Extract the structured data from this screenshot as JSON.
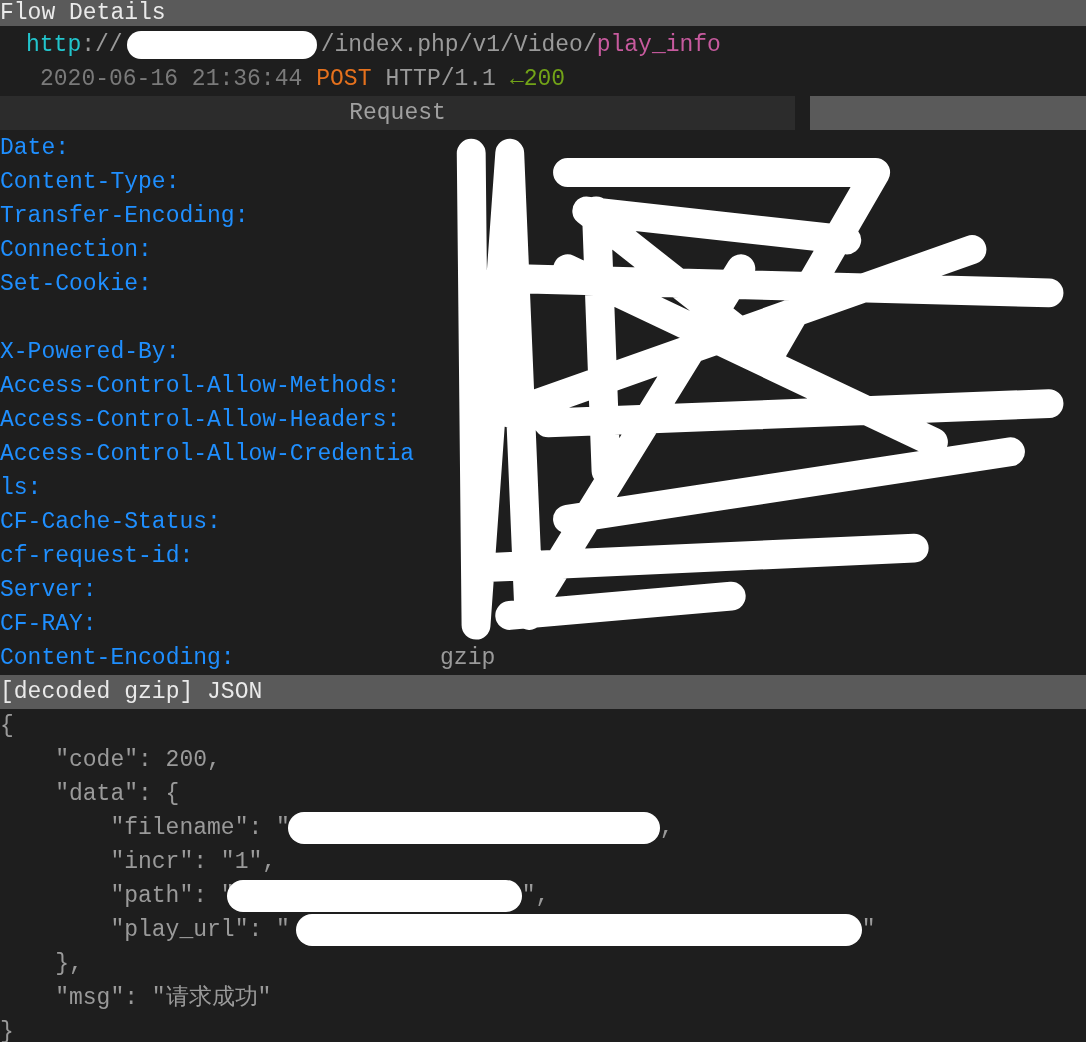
{
  "title_bar": {
    "title": "Flow Details"
  },
  "flow": {
    "scheme": "http",
    "separator": "://",
    "path": "/index.php/v1/Video/",
    "endpoint": "play_info",
    "timestamp": "2020-06-16 21:36:44",
    "method": "POST",
    "protocol": "HTTP/1.1",
    "arrow": "←",
    "status": "200"
  },
  "tabs": [
    {
      "label": "Request",
      "selected": false
    }
  ],
  "headers": [
    {
      "name": "Date:",
      "kind": "single"
    },
    {
      "name": "Content-Type:",
      "kind": "single"
    },
    {
      "name": "Transfer-Encoding:",
      "kind": "single"
    },
    {
      "name": "Connection:",
      "kind": "single"
    },
    {
      "name": "Set-Cookie:",
      "kind": "double"
    },
    {
      "name": "X-Powered-By:",
      "kind": "single"
    },
    {
      "name": "Access-Control-Allow-Methods:",
      "kind": "single"
    },
    {
      "name": "Access-Control-Allow-Headers:",
      "kind": "single"
    },
    {
      "name": "Access-Control-Allow-Credentials:",
      "kind": "single"
    },
    {
      "name": "CF-Cache-Status:",
      "kind": "single"
    },
    {
      "name": "cf-request-id:",
      "kind": "single"
    },
    {
      "name": "Server:",
      "kind": "single"
    },
    {
      "name": "CF-RAY:",
      "kind": "single"
    },
    {
      "name": "Content-Encoding:",
      "kind": "single",
      "value": "gzip"
    }
  ],
  "body_bar": {
    "title": "[decoded gzip] JSON"
  },
  "body": [
    {
      "text": "{",
      "children": [
        {
          "text": "\"code\": 200,"
        },
        {
          "text": "\"data\": {",
          "children": [
            {
              "text": "\"filename\": \"",
              "redacted": true,
              "tail": ","
            },
            {
              "text": "\"incr\": \"1\","
            },
            {
              "text": "\"path\": \"",
              "redacted": true,
              "tail": "\","
            },
            {
              "text": "\"play_url\": \"",
              "redacted": true,
              "tail": "\""
            }
          ]
        },
        {
          "text": "},"
        },
        {
          "text": "\"msg\": \"请求成功\""
        }
      ]
    },
    {
      "text": "}"
    }
  ]
}
